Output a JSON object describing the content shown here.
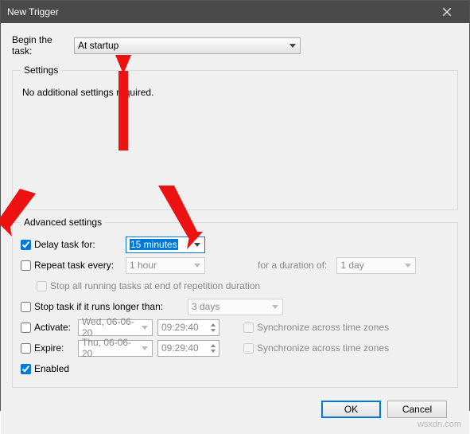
{
  "titlebar": {
    "title": "New Trigger"
  },
  "begin": {
    "label": "Begin the task:",
    "value": "At startup"
  },
  "settings": {
    "legend": "Settings",
    "message": "No additional settings required."
  },
  "advanced": {
    "legend": "Advanced settings",
    "delay": {
      "checked": true,
      "label": "Delay task for:",
      "value": "15 minutes"
    },
    "repeat": {
      "checked": false,
      "label": "Repeat task every:",
      "value": "1 hour",
      "duration_label": "for a duration of:",
      "duration_value": "1 day"
    },
    "stop_all_label": "Stop all running tasks at end of repetition duration",
    "stop_longer": {
      "checked": false,
      "label": "Stop task if it runs longer than:",
      "value": "3 days"
    },
    "activate": {
      "checked": false,
      "label": "Activate:",
      "date": "Wed, 06-06-20",
      "time": "09:29:40",
      "sync_label": "Synchronize across time zones"
    },
    "expire": {
      "checked": false,
      "label": "Expire:",
      "date": "Thu, 06-06-20",
      "time": "09:29:40",
      "sync_label": "Synchronize across time zones"
    },
    "enabled": {
      "checked": true,
      "label": "Enabled"
    }
  },
  "footer": {
    "ok": "OK",
    "cancel": "Cancel"
  },
  "watermark": "wsxdn.com"
}
